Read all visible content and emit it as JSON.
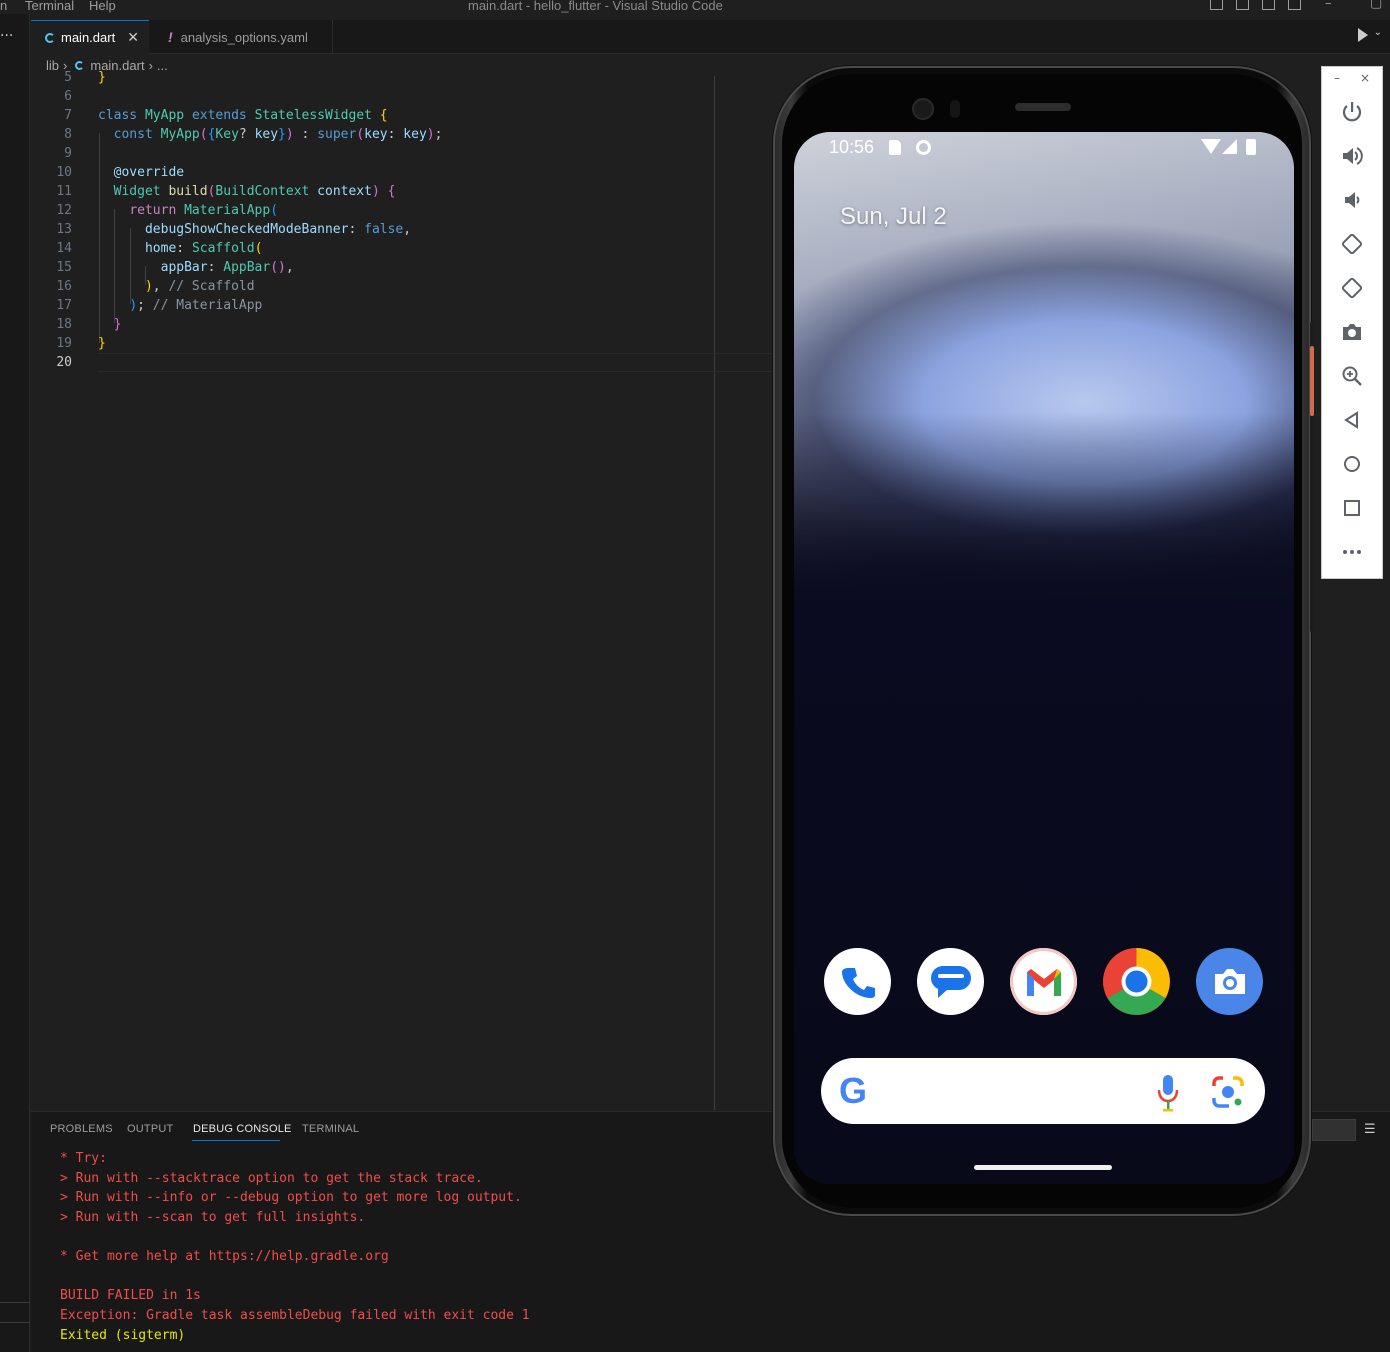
{
  "titlebar": {
    "menus": [
      "n",
      "Terminal",
      "Help"
    ],
    "title": "main.dart - hello_flutter - Visual Studio Code"
  },
  "tabs": [
    {
      "label": "main.dart",
      "active": true,
      "icon": "dart-icon"
    },
    {
      "label": "analysis_options.yaml",
      "active": false,
      "icon": "yaml-warning-icon"
    }
  ],
  "breadcrumb": {
    "folder": "lib",
    "file": "main.dart",
    "more": "..."
  },
  "editor": {
    "line_numbers": [
      "5",
      "6",
      "7",
      "8",
      "9",
      "10",
      "11",
      "12",
      "13",
      "14",
      "15",
      "16",
      "17",
      "18",
      "19",
      "20"
    ],
    "current_line": "20"
  },
  "panel": {
    "tabs": [
      "PROBLEMS",
      "OUTPUT",
      "DEBUG CONSOLE",
      "TERMINAL"
    ],
    "active_tab": "DEBUG CONSOLE",
    "console": [
      "* Try:",
      "> Run with --stacktrace option to get the stack trace.",
      "> Run with --info or --debug option to get more log output.",
      "> Run with --scan to get full insights.",
      "",
      "* Get more help at https://help.gradle.org",
      "",
      "BUILD FAILED in 1s",
      "Exception: Gradle task assembleDebug failed with exit code 1",
      "Exited (sigterm)"
    ]
  },
  "phone": {
    "time": "10:56",
    "date": "Sun, Jul 2",
    "dock_apps": [
      "phone-app-icon",
      "messages-app-icon",
      "gmail-app-icon",
      "chrome-app-icon",
      "camera-app-icon"
    ],
    "search_logo": "G"
  },
  "emulator_toolbar": {
    "minimize": "–",
    "close": "×",
    "buttons": [
      "power-icon",
      "volume-up-icon",
      "volume-down-icon",
      "rotate-left-icon",
      "rotate-right-icon",
      "screenshot-icon",
      "zoom-icon",
      "back-icon",
      "home-icon",
      "overview-icon",
      "more-icon"
    ]
  },
  "colors": {
    "accent": "#0078d4",
    "error_text": "#f14c4c",
    "exit_text": "#e5e510",
    "editor_bg": "#1f1f1f"
  }
}
